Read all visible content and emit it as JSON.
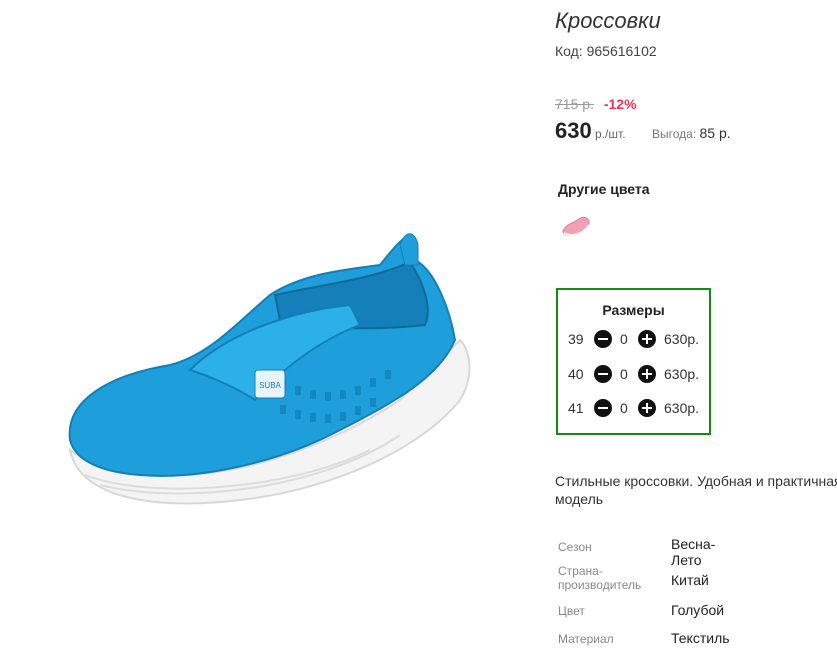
{
  "product": {
    "title": "Кроссовки",
    "code": "Код: 965616102",
    "image_alt": "blue-mesh-slip-on-sneaker",
    "logo_text": "SUBA"
  },
  "pricing": {
    "old_price": "715 р.",
    "discount": "-12%",
    "price": "630",
    "unit": " р./шт.",
    "savings_label": "Выгода: ",
    "savings_value": "85 р."
  },
  "other_colors": {
    "title": "Другие цвета",
    "swatches": [
      {
        "color_name": "pink",
        "color": "#f2a0b4"
      }
    ]
  },
  "sizes": {
    "title": "Размеры",
    "rows": [
      {
        "size": "39",
        "qty": "0",
        "price": "630р."
      },
      {
        "size": "40",
        "qty": "0",
        "price": "630р."
      },
      {
        "size": "41",
        "qty": "0",
        "price": "630р."
      }
    ],
    "border_color": "#138a13"
  },
  "description": "Стильные кроссовки. Удобная и практичная модель",
  "specs": [
    {
      "label": "Сезон",
      "value": "Весна-Лето"
    },
    {
      "label": "Страна-производитель",
      "value": "Китай"
    },
    {
      "label": "Цвет",
      "value": "Голубой"
    },
    {
      "label": "Материал",
      "value": "Текстиль"
    }
  ],
  "colors": {
    "discount": "#e8384f",
    "shoe_main": "#1e9fdc",
    "shoe_sole": "#f4f4f4"
  }
}
